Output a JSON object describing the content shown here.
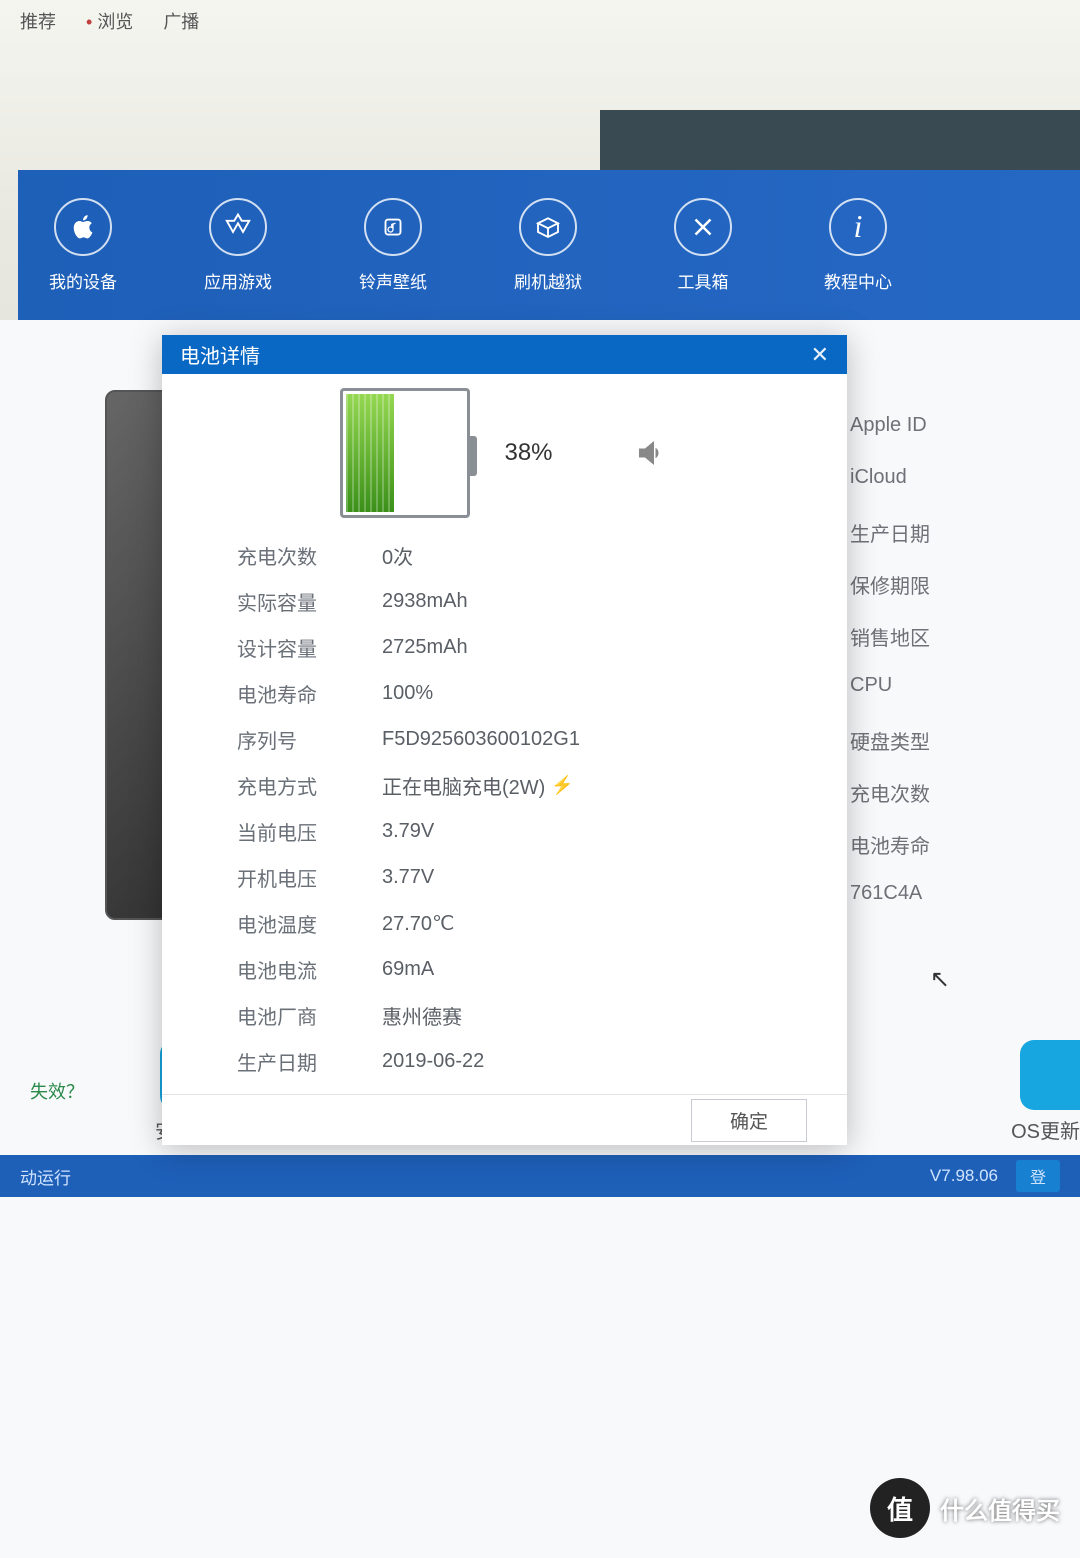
{
  "browser_tabs": {
    "recommend": "推荐",
    "browse": "浏览",
    "broadcast": "广播"
  },
  "toolbar": [
    {
      "label": "我的设备",
      "icon": "apple"
    },
    {
      "label": "应用游戏",
      "icon": "apps"
    },
    {
      "label": "铃声壁纸",
      "icon": "music"
    },
    {
      "label": "刷机越狱",
      "icon": "box"
    },
    {
      "label": "工具箱",
      "icon": "tools"
    },
    {
      "label": "教程中心",
      "icon": "info"
    }
  ],
  "side_labels": [
    "Apple ID",
    "iCloud",
    "生产日期",
    "保修期限",
    "销售地区",
    "CPU",
    "硬盘类型",
    "充电次数",
    "电池寿命",
    "761C4A"
  ],
  "modal": {
    "title": "电池详情",
    "percent": "38%",
    "fill_pct": 38,
    "ok": "确定"
  },
  "details": [
    {
      "label": "充电次数",
      "value": "0次"
    },
    {
      "label": "实际容量",
      "value": "2938mAh"
    },
    {
      "label": "设计容量",
      "value": "2725mAh"
    },
    {
      "label": "电池寿命",
      "value": "100%"
    },
    {
      "label": "序列号",
      "value": "F5D925603600102G1"
    },
    {
      "label": "充电方式",
      "value": "正在电脑充电(2W)",
      "bolt": true
    },
    {
      "label": "当前电压",
      "value": "3.79V"
    },
    {
      "label": "开机电压",
      "value": "3.77V"
    },
    {
      "label": "电池温度",
      "value": "27.70℃"
    },
    {
      "label": "电池电流",
      "value": "69mA"
    },
    {
      "label": "电池厂商",
      "value": "惠州德赛"
    },
    {
      "label": "生产日期",
      "value": "2019-06-22"
    }
  ],
  "bg": {
    "question": "失效？",
    "install": "安装移",
    "os_update": "OS更新",
    "install_icon": "iu"
  },
  "footer": {
    "run": "动运行",
    "version": "V7.98.06",
    "login": "登"
  },
  "watermark": {
    "badge": "值",
    "text": "什么值得买"
  }
}
